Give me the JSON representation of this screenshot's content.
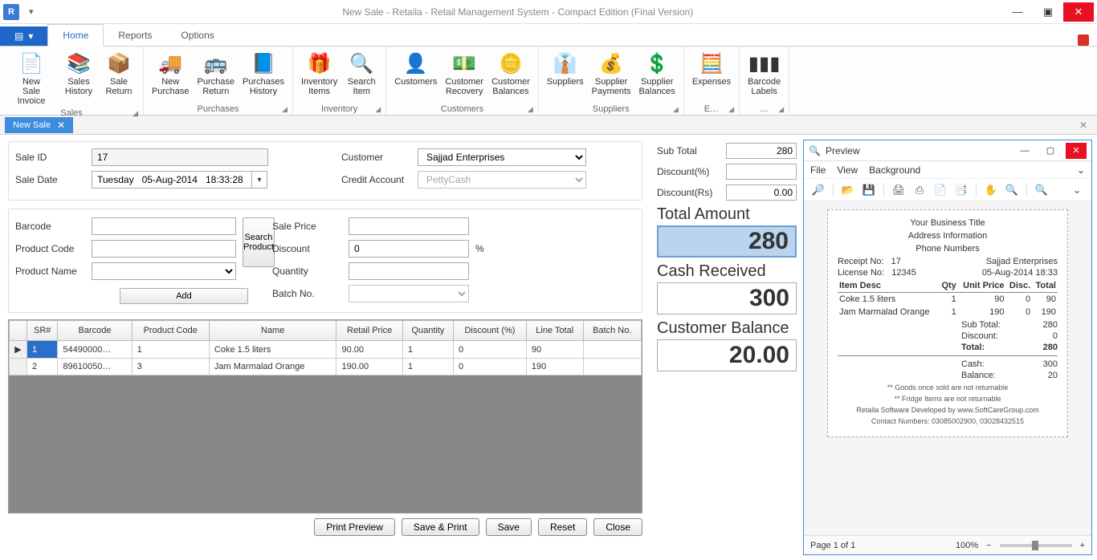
{
  "window": {
    "title": "New Sale - Retaila - Retail Management System - Compact Edition (Final Version)"
  },
  "menu": {
    "file": "",
    "tabs": [
      "Home",
      "Reports",
      "Options"
    ]
  },
  "ribbon": {
    "groups": [
      {
        "label": "Sales",
        "items": [
          {
            "label": "New Sale Invoice",
            "icon": "📄"
          },
          {
            "label": "Sales History",
            "icon": "📚"
          },
          {
            "label": "Sale Return",
            "icon": "📦"
          }
        ]
      },
      {
        "label": "Purchases",
        "items": [
          {
            "label": "New Purchase",
            "icon": "🚚"
          },
          {
            "label": "Purchase Return",
            "icon": "🚌"
          },
          {
            "label": "Purchases History",
            "icon": "📘"
          }
        ]
      },
      {
        "label": "Inventory",
        "items": [
          {
            "label": "Inventory Items",
            "icon": "🎁"
          },
          {
            "label": "Search Item",
            "icon": "🔍"
          }
        ]
      },
      {
        "label": "Customers",
        "items": [
          {
            "label": "Customers",
            "icon": "👤"
          },
          {
            "label": "Customer Recovery",
            "icon": "💵"
          },
          {
            "label": "Customer Balances",
            "icon": "🪙"
          }
        ]
      },
      {
        "label": "Suppliers",
        "items": [
          {
            "label": "Suppliers",
            "icon": "👔"
          },
          {
            "label": "Supplier Payments",
            "icon": "💰"
          },
          {
            "label": "Supplier Balances",
            "icon": "💲"
          }
        ]
      },
      {
        "label": "E…",
        "items": [
          {
            "label": "Expenses",
            "icon": "🧮"
          }
        ]
      },
      {
        "label": "…",
        "items": [
          {
            "label": "Barcode Labels",
            "icon": "▮▮▮"
          }
        ]
      }
    ]
  },
  "doctab": {
    "title": "New Sale"
  },
  "form": {
    "sale_id_label": "Sale ID",
    "sale_id": "17",
    "sale_date_label": "Sale Date",
    "sale_date": "Tuesday   05-Aug-2014   18:33:28",
    "customer_label": "Customer",
    "customer": "Sajjad Enterprises",
    "credit_label": "Credit Account",
    "credit": "PettyCash",
    "barcode_label": "Barcode",
    "barcode": "",
    "pcode_label": "Product Code",
    "pcode": "",
    "pname_label": "Product Name",
    "pname": "",
    "search_btn": "Search Product",
    "add_btn": "Add",
    "saleprice_label": "Sale Price",
    "saleprice": "",
    "discount_label": "Discount",
    "discount": "0",
    "discount_unit": "%",
    "qty_label": "Quantity",
    "qty": "",
    "batch_label": "Batch No.",
    "batch": ""
  },
  "grid": {
    "cols": [
      "",
      "SR#",
      "Barcode",
      "Product Code",
      "Name",
      "Retail Price",
      "Quantity",
      "Discount (%)",
      "Line Total",
      "Batch No."
    ],
    "rows": [
      {
        "rh": "▶",
        "sr": "1",
        "bc": "54490000…",
        "pc": "1",
        "name": "Coke 1.5 liters",
        "price": "90.00",
        "qty": "1",
        "disc": "0",
        "total": "90",
        "batch": ""
      },
      {
        "rh": "",
        "sr": "2",
        "bc": "89610050…",
        "pc": "3",
        "name": "Jam Marmalad Orange",
        "price": "190.00",
        "qty": "1",
        "disc": "0",
        "total": "190",
        "batch": ""
      }
    ]
  },
  "buttons": {
    "preview": "Print Preview",
    "saveprint": "Save & Print",
    "save": "Save",
    "reset": "Reset",
    "close": "Close"
  },
  "totals": {
    "subtotal_label": "Sub Total",
    "subtotal": "280",
    "discpct_label": "Discount(%)",
    "discpct": "",
    "discrs_label": "Discount(Rs)",
    "discrs": "0.00",
    "total_label": "Total Amount",
    "total": "280",
    "cash_label": "Cash Received",
    "cash": "300",
    "bal_label": "Customer Balance",
    "bal": "20.00"
  },
  "preview": {
    "title": "Preview",
    "menu": [
      "File",
      "View",
      "Background"
    ],
    "header": {
      "biz": "Your Business Title",
      "addr": "Address Information",
      "phone": "Phone Numbers",
      "receipt_label": "Receipt No:",
      "receipt": "17",
      "cust": "Sajjad Enterprises",
      "lic_label": "License No:",
      "lic": "12345",
      "date": "05-Aug-2014 18:33"
    },
    "cols": [
      "Item Desc",
      "Qty",
      "Unit Price",
      "Disc.",
      "Total"
    ],
    "rows": [
      {
        "d": "Coke 1.5 liters",
        "q": "1",
        "u": "90",
        "dc": "0",
        "t": "90"
      },
      {
        "d": "Jam Marmalad Orange",
        "q": "1",
        "u": "190",
        "dc": "0",
        "t": "190"
      }
    ],
    "summary": [
      {
        "l": "Sub Total:",
        "v": "280"
      },
      {
        "l": "Discount:",
        "v": "0"
      },
      {
        "l": "Total:",
        "v": "280",
        "b": true
      },
      {
        "l": "Cash:",
        "v": "300"
      },
      {
        "l": "Balance:",
        "v": "20"
      }
    ],
    "notes": [
      "** Goods once sold are not returnable",
      "** Fridge Items are not returnable",
      "Retaila Software Developed by www.SoftCareGroup.com",
      "Contact Numbers: 03085002900, 03028432515"
    ],
    "status": {
      "page": "Page 1 of 1",
      "zoom": "100%"
    }
  }
}
